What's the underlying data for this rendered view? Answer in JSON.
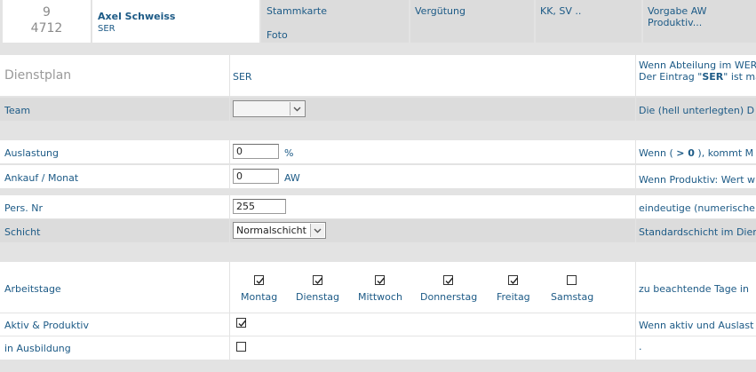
{
  "header": {
    "id_number": "9",
    "id_code": "4712",
    "employee_name": "Axel Schweiss",
    "employee_dept": "SER",
    "tab_stammkarte": "Stammkarte",
    "tab_foto": "Foto",
    "tab_verguetung": "Vergütung",
    "tab_kk_sv": "KK, SV ..",
    "tab_vorgabe_line1": "Vorgabe AW",
    "tab_vorgabe_line2": "Produktiv..."
  },
  "dienstplan": {
    "title": "Dienstplan",
    "value": "SER",
    "hint_line1": "Wenn Abteilung im WER",
    "hint_line2_pre": "Der Eintrag \"",
    "hint_line2_bold": "SER",
    "hint_line2_post": "\" ist ma"
  },
  "team": {
    "label": "Team",
    "selected": "",
    "hint": "Die (hell unterlegten) D"
  },
  "auslastung": {
    "label": "Auslastung",
    "value": "0",
    "unit": "%",
    "hint_pre": "Wenn ( ",
    "hint_bold": "> 0",
    "hint_post": " ), kommt M"
  },
  "ankauf": {
    "label": "Ankauf / Monat",
    "value": "0",
    "unit": "AW",
    "hint": "Wenn Produktiv: Wert w"
  },
  "persnr": {
    "label": "Pers. Nr",
    "value": "255",
    "hint": "eindeutige (numerische"
  },
  "schicht": {
    "label": "Schicht",
    "selected": "Normalschicht",
    "hint": "Standardschicht im Dien"
  },
  "arbeitstage": {
    "label": "Arbeitstage",
    "hint": "zu beachtende Tage in",
    "days": [
      {
        "name": "Montag",
        "checked": true
      },
      {
        "name": "Dienstag",
        "checked": true
      },
      {
        "name": "Mittwoch",
        "checked": true
      },
      {
        "name": "Donnerstag",
        "checked": true
      },
      {
        "name": "Freitag",
        "checked": true
      },
      {
        "name": "Samstag",
        "checked": false
      }
    ]
  },
  "aktiv": {
    "label": "Aktiv & Produktiv",
    "checked": true,
    "hint": "Wenn aktiv und Auslast"
  },
  "ausbildung": {
    "label": "in Ausbildung",
    "checked": false,
    "hint": "."
  }
}
